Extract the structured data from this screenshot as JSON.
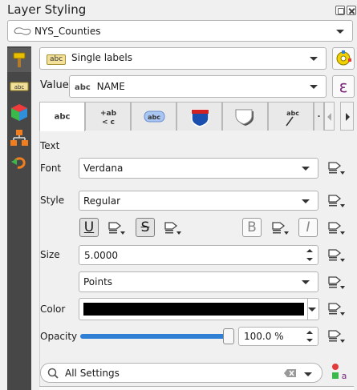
{
  "panel": {
    "title": "Layer Styling"
  },
  "layer_select": {
    "value": "NYS_Counties"
  },
  "renderer": {
    "value": "Single labels",
    "tag": "abc"
  },
  "value": {
    "label": "Value",
    "tag": "abc",
    "field": "NAME",
    "expression_symbol": "ε"
  },
  "tabs": [
    {
      "glyph": "abc",
      "name": "Text"
    },
    {
      "glyph": "+ab\n< c",
      "name": "Formatting"
    },
    {
      "glyph": "abc",
      "name": "Buffer"
    },
    {
      "glyph": "",
      "name": "Background"
    },
    {
      "glyph": "",
      "name": "Shadow"
    },
    {
      "glyph": "abc",
      "name": "Callouts"
    },
    {
      "glyph": "·",
      "name": "Placement"
    }
  ],
  "text_section": {
    "heading": "Text",
    "font_label": "Font",
    "font_value": "Verdana",
    "style_label": "Style",
    "style_value": "Regular",
    "underline": "U",
    "strikeout": "S",
    "bold": "B",
    "italic": "I",
    "size_label": "Size",
    "size_value": "5.0000",
    "unit_value": "Points",
    "color_label": "Color",
    "color_value": "#000000",
    "opacity_label": "Opacity",
    "opacity_value": "100.0 %",
    "opacity_fraction": 1.0
  },
  "search": {
    "value": "All Settings"
  },
  "colors": {
    "sidebar": "#474747",
    "slider": "#2f7fd4",
    "accent_tag": "#f3e19a",
    "expression": "#7a2a78"
  }
}
